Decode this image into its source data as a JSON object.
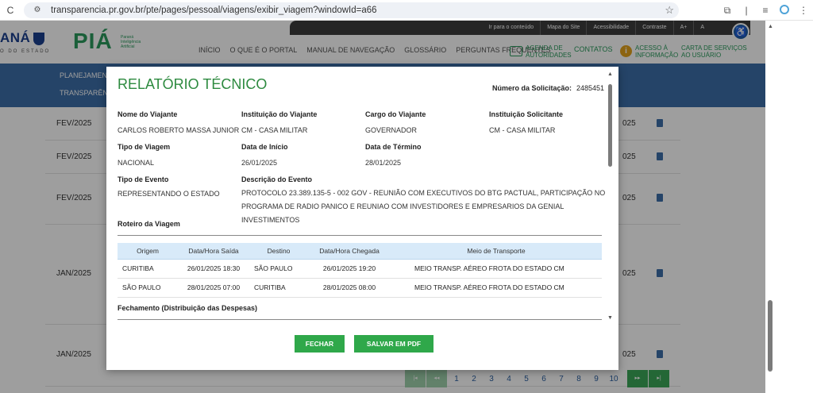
{
  "browser": {
    "reload_icon": "reload-icon",
    "url": "transparencia.pr.gov.br/pte/pages/pessoal/viagens/exibir_viagem?windowId=a66"
  },
  "header": {
    "gov_logo": "ANÁ",
    "gov_sub": "O DO ESTADO",
    "pia_logo": "PIÁ",
    "pia_sub": "Paraná Inteligência Artificial",
    "top_links": [
      "Ir para o conteúdo",
      "Mapa do Site",
      "Acessibilidade",
      "Contraste",
      "A+",
      "A"
    ],
    "nav": [
      "INÍCIO",
      "O QUE É O PORTAL",
      "MANUAL DE NAVEGAÇÃO",
      "GLOSSÁRIO",
      "PERGUNTAS FREQUENTES"
    ],
    "agenda_l1": "AGENDA DE",
    "agenda_l2": "AUTORIDADES",
    "contatos": "CONTATOS",
    "acesso_l1": "ACESSO À",
    "acesso_l2": "INFORMAÇÃO",
    "carta_l1": "CARTA DE SERVIÇOS",
    "carta_l2": "AO USUÁRIO"
  },
  "band": {
    "line1": "PLANEJAMENT",
    "line2": "TRANSPARÊNC"
  },
  "background_rows": [
    {
      "month": "FEV/2025",
      "right": "025"
    },
    {
      "month": "FEV/2025",
      "right": "025"
    },
    {
      "month": "FEV/2025",
      "right": "025"
    },
    {
      "month": "JAN/2025",
      "right": "025"
    },
    {
      "month": "JAN/2025",
      "right": "025"
    }
  ],
  "pagination": {
    "pages": [
      "1",
      "2",
      "3",
      "4",
      "5",
      "6",
      "7",
      "8",
      "9",
      "10"
    ]
  },
  "modal": {
    "title": "RELATÓRIO TÉCNICO",
    "request_label": "Número da Solicitação:",
    "request_value": "2485451",
    "fields": {
      "traveler_label": "Nome do Viajante",
      "traveler_value": "CARLOS ROBERTO MASSA JUNIOR",
      "traveler_inst_label": "Instituição do Viajante",
      "traveler_inst_value": "CM - CASA MILITAR",
      "position_label": "Cargo do Viajante",
      "position_value": "GOVERNADOR",
      "requesting_inst_label": "Instituição Solicitante",
      "requesting_inst_value": "CM - CASA MILITAR",
      "trip_type_label": "Tipo de Viagem",
      "trip_type_value": "NACIONAL",
      "start_label": "Data de Início",
      "start_value": "26/01/2025",
      "end_label": "Data de Término",
      "end_value": "28/01/2025",
      "event_type_label": "Tipo de Evento",
      "event_type_value": "REPRESENTANDO O ESTADO",
      "event_desc_label": "Descrição do Evento",
      "event_desc_value": "PROTOCOLO 23.389.135-5 - 002 GOV - REUNIÃO COM EXECUTIVOS DO BTG PACTUAL, PARTICIPAÇÃO NO PROGRAMA DE RADIO PANICO E REUNIAO COM INVESTIDORES E EMPRESARIOS DA GENIAL INVESTIMENTOS"
    },
    "itinerary_title": "Roteiro da Viagem",
    "itinerary_columns": [
      "Origem",
      "Data/Hora Saída",
      "Destino",
      "Data/Hora Chegada",
      "Meio de Transporte"
    ],
    "itinerary_rows": [
      [
        "CURITIBA",
        "26/01/2025 18:30",
        "SÃO PAULO",
        "26/01/2025 19:20",
        "MEIO TRANSP. AÉREO FROTA DO ESTADO CM"
      ],
      [
        "SÃO PAULO",
        "28/01/2025 07:00",
        "CURITIBA",
        "28/01/2025 08:00",
        "MEIO TRANSP. AÉREO FROTA DO ESTADO CM"
      ]
    ],
    "closing_title": "Fechamento (Distribuição das Despesas)",
    "close_button": "FECHAR",
    "pdf_button": "SALVAR EM PDF"
  },
  "colors": {
    "accent_green": "#2fa84a",
    "title_green": "#2d8a3f",
    "band_blue": "#3d6ea8",
    "table_header": "#d8eaf9"
  }
}
